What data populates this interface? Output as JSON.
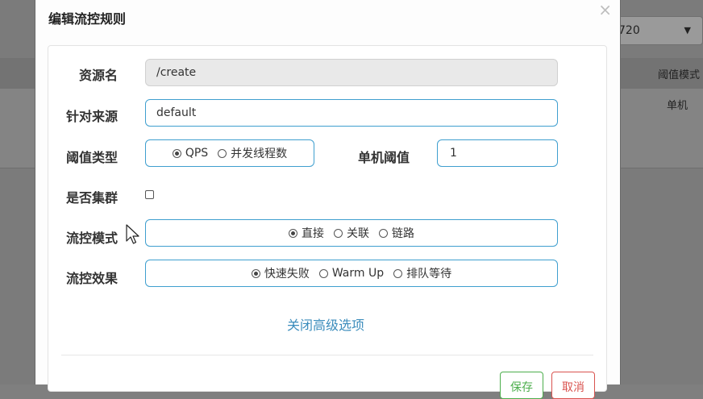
{
  "background": {
    "select_value": "720",
    "header_label": "阈值模式",
    "cell_value": "单机"
  },
  "modal": {
    "title": "编辑流控规则",
    "close_symbol": "×",
    "resource": {
      "label": "资源名",
      "value": "/create"
    },
    "source": {
      "label": "针对来源",
      "value": "default"
    },
    "threshold_type": {
      "label": "阈值类型",
      "options": [
        "QPS",
        "并发线程数"
      ],
      "selected": "QPS"
    },
    "single_threshold": {
      "label": "单机阈值",
      "value": "1"
    },
    "cluster": {
      "label": "是否集群",
      "checked": false
    },
    "flow_mode": {
      "label": "流控模式",
      "options": [
        "直接",
        "关联",
        "链路"
      ],
      "selected": "直接"
    },
    "flow_effect": {
      "label": "流控效果",
      "options": [
        "快速失败",
        "Warm Up",
        "排队等待"
      ],
      "selected": "快速失败"
    },
    "advanced_toggle": "关闭高级选项",
    "save_label": "保存",
    "cancel_label": "取消"
  }
}
